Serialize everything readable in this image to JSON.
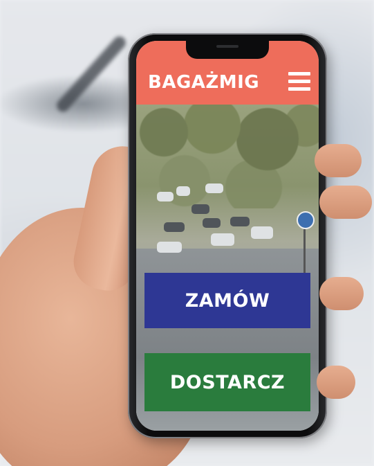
{
  "app": {
    "brand": "BAGAŻMIG"
  },
  "header": {
    "menu_icon": "hamburger-menu-icon"
  },
  "actions": {
    "order_label": "ZAMÓW",
    "deliver_label": "DOSTARCZ"
  },
  "colors": {
    "header": "#ee6d5b",
    "order_button": "#2e3794",
    "deliver_button": "#2a7c3d"
  }
}
